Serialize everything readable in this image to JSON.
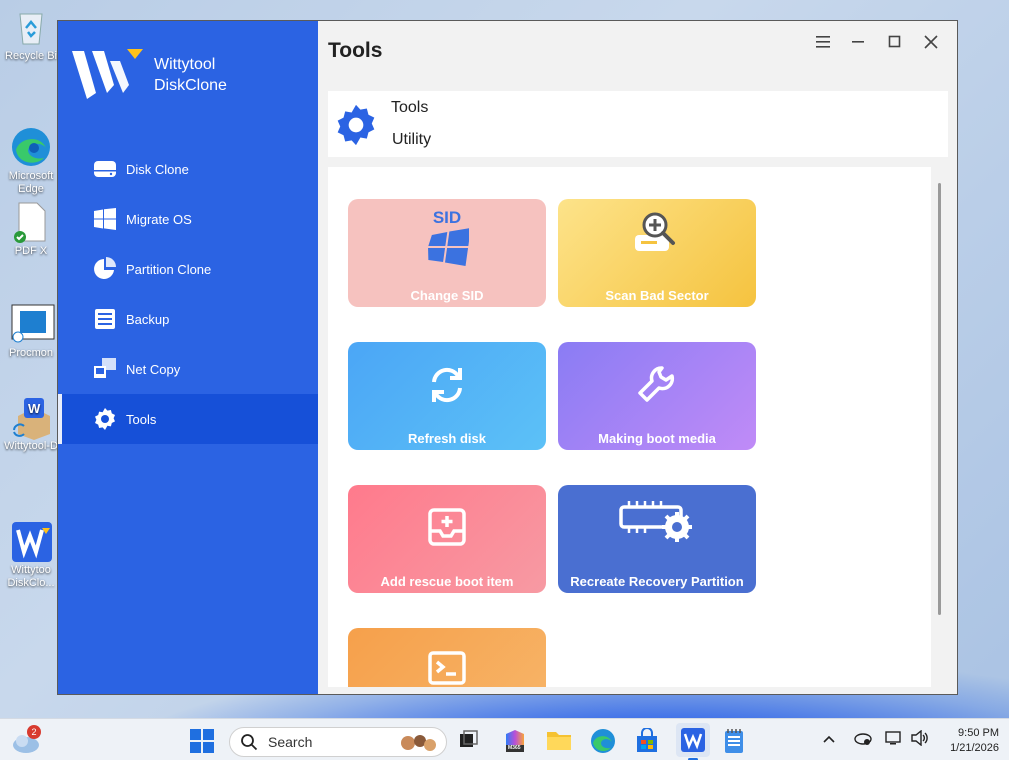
{
  "desktop": {
    "icons": [
      {
        "label": "Recycle Bi"
      },
      {
        "label": "Microsoft\nEdge"
      },
      {
        "label": "PDF X"
      },
      {
        "label": "Procmon"
      },
      {
        "label": "Wittytool-D"
      },
      {
        "label": "Wittytoo\nDiskClo..."
      }
    ]
  },
  "app": {
    "brand_line1": "Wittytool",
    "brand_line2": "DiskClone",
    "page_title": "Tools",
    "header_title": "Tools",
    "header_subtitle": "Utility",
    "accent": "#2b63e3"
  },
  "sidebar": {
    "items": [
      {
        "label": "Disk Clone",
        "icon": "disk-icon"
      },
      {
        "label": "Migrate OS",
        "icon": "windows-icon"
      },
      {
        "label": "Partition Clone",
        "icon": "pie-icon"
      },
      {
        "label": "Backup",
        "icon": "backup-icon"
      },
      {
        "label": "Net Copy",
        "icon": "network-icon"
      },
      {
        "label": "Tools",
        "icon": "gear-icon",
        "active": true
      }
    ]
  },
  "tools": [
    {
      "label": "Change SID",
      "sid_text": "SID"
    },
    {
      "label": "Scan Bad Sector"
    },
    {
      "label": "Refresh disk"
    },
    {
      "label": "Making boot media"
    },
    {
      "label": "Add rescue boot item"
    },
    {
      "label": "Recreate Recovery Partition"
    },
    {
      "label": ""
    }
  ],
  "taskbar": {
    "search_placeholder": "Search",
    "time": "9:50 PM",
    "date": "1/21/2026",
    "weather_badge": "2",
    "m365_label": "M365"
  }
}
